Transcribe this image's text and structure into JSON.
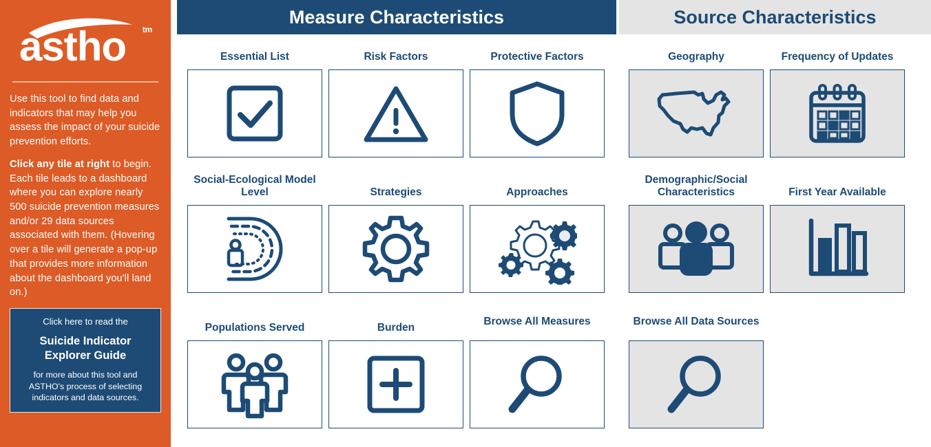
{
  "sidebar": {
    "logo_text": "astho",
    "logo_tm": "tm",
    "intro_paragraph_1": "Use this tool to find data and indicators that may help you assess the impact of your suicide prevention efforts.",
    "intro_bold": "Click any tile at right",
    "intro_paragraph_2": " to begin. Each tile leads to a dashboard where you can explore nearly 500 suicide prevention measures and/or 29 data sources associated with them. (Hovering over a tile will generate a pop-up that provides more information about the dashboard you'll land on.)",
    "guide": {
      "top_line": "Click here to read the",
      "title": "Suicide Indicator Explorer Guide",
      "sub_line": "for more about this tool and ASTHO's process of selecting indicators and data sources."
    },
    "colors": {
      "background": "#dd5b26",
      "guide_box": "#1d4b75",
      "divider": "#f0b79c"
    }
  },
  "banners": {
    "measure": "Measure Characteristics",
    "source": "Source Characteristics",
    "measure_bg": "#1d4b75",
    "source_bg": "#e4e4e4",
    "accent": "#1d4b75"
  },
  "tiles": {
    "measure": [
      {
        "label": "Essential List",
        "icon": "checkbox-check-icon",
        "style": "white"
      },
      {
        "label": "Risk Factors",
        "icon": "warning-triangle-icon",
        "style": "white"
      },
      {
        "label": "Protective Factors",
        "icon": "shield-icon",
        "style": "white"
      },
      {
        "label": "Social-Ecological Model Level",
        "icon": "concentric-arcs-person-icon",
        "style": "white"
      },
      {
        "label": "Strategies",
        "icon": "gear-icon",
        "style": "white"
      },
      {
        "label": "Approaches",
        "icon": "multiple-gears-icon",
        "style": "white"
      },
      {
        "label": "Populations Served",
        "icon": "three-people-icon",
        "style": "white"
      },
      {
        "label": "Burden",
        "icon": "plus-in-square-icon",
        "style": "white"
      },
      {
        "label": "Browse All Measures",
        "icon": "magnifier-icon",
        "style": "white"
      }
    ],
    "source": [
      {
        "label": "Geography",
        "icon": "us-map-icon",
        "style": "gray"
      },
      {
        "label": "Frequency of Updates",
        "icon": "calendar-icon",
        "style": "gray"
      },
      {
        "label": "Demographic/Social Characteristics",
        "icon": "group-people-filled-icon",
        "style": "gray"
      },
      {
        "label": "First Year Available",
        "icon": "bar-chart-icon",
        "style": "gray"
      },
      {
        "label": "Browse All Data Sources",
        "icon": "magnifier-icon",
        "style": "gray"
      }
    ]
  }
}
